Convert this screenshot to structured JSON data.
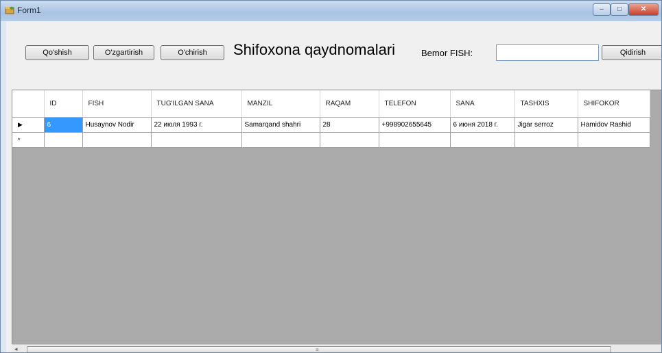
{
  "window": {
    "title": "Form1",
    "minimize": "–",
    "maximize": "□",
    "close": "✕"
  },
  "toolbar": {
    "add_label": "Qo'shish",
    "edit_label": "O'zgartirish",
    "delete_label": "O'chirish",
    "heading": "Shifoxona qaydnomalari",
    "patient_label": "Bemor FISH:",
    "patient_value": "",
    "search_label": "Qidirish"
  },
  "grid": {
    "columns": [
      "ID",
      "FISH",
      "TUG'ILGAN SANA",
      "MANZIL",
      "RAQAM",
      "TELEFON",
      "SANA",
      "TASHXIS",
      "SHIFOKOR"
    ],
    "rows": [
      {
        "marker": "▶",
        "cells": [
          "6",
          "Husaynov Nodir",
          "22 июля 1993 г.",
          "Samarqand shahri",
          "28",
          "+998902655645",
          "6 июня 2018 г.",
          "Jigar serroz",
          "Hamidov Rashid"
        ]
      }
    ],
    "new_row_marker": "*"
  },
  "scrollbar": {
    "left_arrow": "◂",
    "grip": "≡"
  },
  "colors": {
    "selection": "#3399ff",
    "grid_background": "#ababab"
  }
}
